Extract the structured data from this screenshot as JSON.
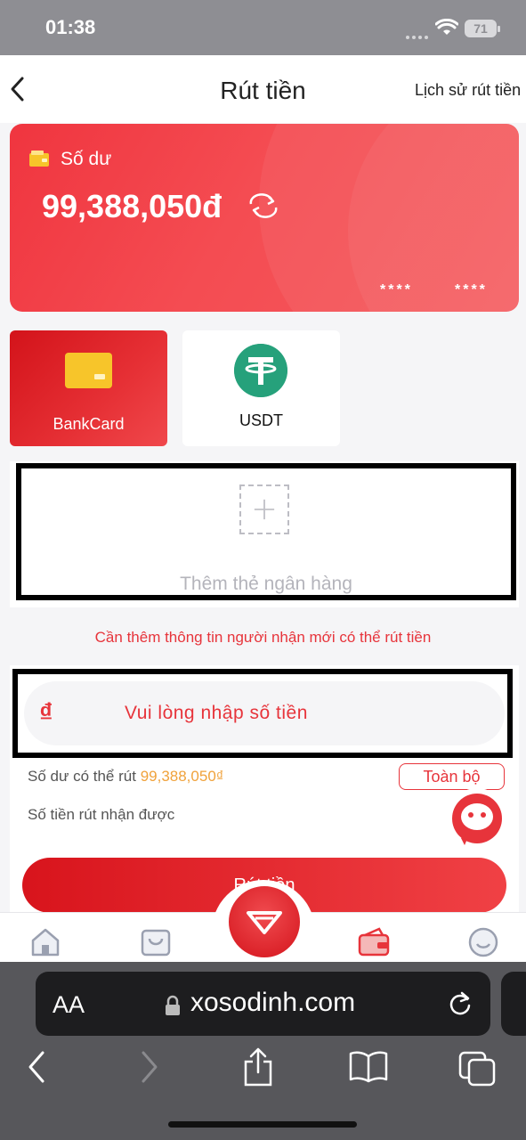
{
  "status_bar": {
    "time": "01:38",
    "battery": "71"
  },
  "header": {
    "title": "Rút tiền",
    "history_link": "Lịch sử rút tiền"
  },
  "balance_card": {
    "label": "Số dư",
    "amount": "99,388,050đ",
    "masked_1": "****",
    "masked_2": "****"
  },
  "methods": [
    {
      "label": "BankCard",
      "selected": true
    },
    {
      "label": "USDT",
      "selected": false
    }
  ],
  "add_card": {
    "label": "Thêm thẻ ngân hàng"
  },
  "hint": "Cần thêm thông tin người nhận mới có thể rút tiền",
  "amount_input": {
    "currency_symbol": "₫",
    "placeholder": "Vui lòng nhập số tiền"
  },
  "withdrawable": {
    "label": "Số dư có thể rút",
    "value": "99,388,050₫"
  },
  "all_button": "Toàn bộ",
  "received_label": "Số tiền rút nhận được",
  "submit_button": "Rút tiền",
  "browser": {
    "text_size": "AA",
    "url": "xosodinh.com"
  },
  "colors": {
    "primary": "#e7343b",
    "accent": "#f0a23b",
    "usdt": "#26a17b",
    "card_yellow": "#f7c52a"
  }
}
